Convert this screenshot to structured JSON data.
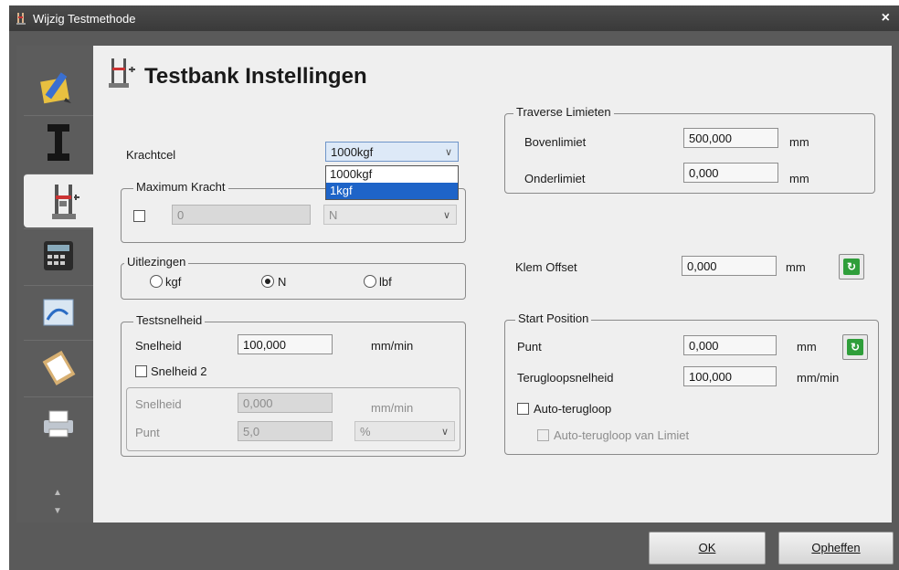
{
  "window": {
    "title": "Wijzig Testmethode",
    "close": "×"
  },
  "page": {
    "heading": "Testbank Instellingen"
  },
  "krachtcel": {
    "label": "Krachtcel",
    "selected": "1000kgf",
    "options": [
      "1000kgf",
      "1kgf"
    ]
  },
  "max_kracht": {
    "legend": "Maximum Kracht",
    "value": "0",
    "unit": "N"
  },
  "uitlezingen": {
    "legend": "Uitlezingen",
    "options": [
      "kgf",
      "N",
      "lbf"
    ],
    "selected": "N"
  },
  "testsnelheid": {
    "legend": "Testsnelheid",
    "snelheid_label": "Snelheid",
    "snelheid_value": "100,000",
    "snelheid_unit": "mm/min",
    "snelheid2_label": "Snelheid 2",
    "sub_snelheid_label": "Snelheid",
    "sub_snelheid_value": "0,000",
    "sub_snelheid_unit": "mm/min",
    "punt_label": "Punt",
    "punt_value": "5,0",
    "punt_unit": "%"
  },
  "traverse": {
    "legend": "Traverse Limieten",
    "boven_label": "Bovenlimiet",
    "boven_value": "500,000",
    "boven_unit": "mm",
    "onder_label": "Onderlimiet",
    "onder_value": "0,000",
    "onder_unit": "mm"
  },
  "klem": {
    "label": "Klem Offset",
    "value": "0,000",
    "unit": "mm"
  },
  "start": {
    "legend": "Start Position",
    "punt_label": "Punt",
    "punt_value": "0,000",
    "punt_unit": "mm",
    "terug_label": "Terugloopsnelheid",
    "terug_value": "100,000",
    "terug_unit": "mm/min",
    "auto_label": "Auto-terugloop",
    "auto_limiet_label": "Auto-terugloop van Limiet"
  },
  "buttons": {
    "ok": "OK",
    "cancel": "Opheffen"
  }
}
